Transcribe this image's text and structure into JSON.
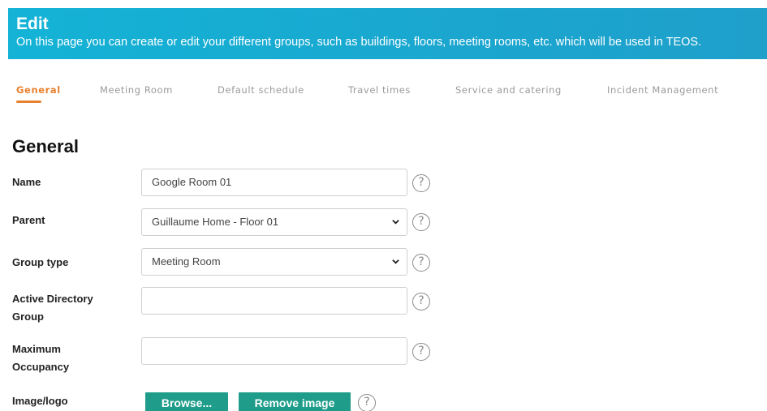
{
  "header": {
    "title": "Edit",
    "description": "On this page you can create or edit your different groups, such as buildings, floors, meeting rooms, etc. which will be used in TEOS."
  },
  "tabs": [
    {
      "label": "General",
      "active": true
    },
    {
      "label": "Meeting Room",
      "active": false
    },
    {
      "label": "Default schedule",
      "active": false
    },
    {
      "label": "Travel times",
      "active": false
    },
    {
      "label": "Service and catering",
      "active": false
    },
    {
      "label": "Incident Management",
      "active": false
    }
  ],
  "section": {
    "title": "General"
  },
  "form": {
    "name": {
      "label": "Name",
      "value": "Google Room 01"
    },
    "parent": {
      "label": "Parent",
      "value": "Guillaume Home - Floor 01"
    },
    "group_type": {
      "label": "Group type",
      "value": "Meeting Room"
    },
    "ad_group": {
      "label_line1": "Active Directory",
      "label_line2": "Group",
      "value": ""
    },
    "max_occupancy": {
      "label_line1": "Maximum",
      "label_line2": "Occupancy",
      "value": ""
    },
    "image": {
      "label": "Image/logo",
      "browse_label": "Browse...",
      "remove_label": "Remove image"
    }
  },
  "help_symbol": "?",
  "colors": {
    "banner": "#14b3d6",
    "tab_active": "#e8812f",
    "button": "#1f9d8a"
  }
}
